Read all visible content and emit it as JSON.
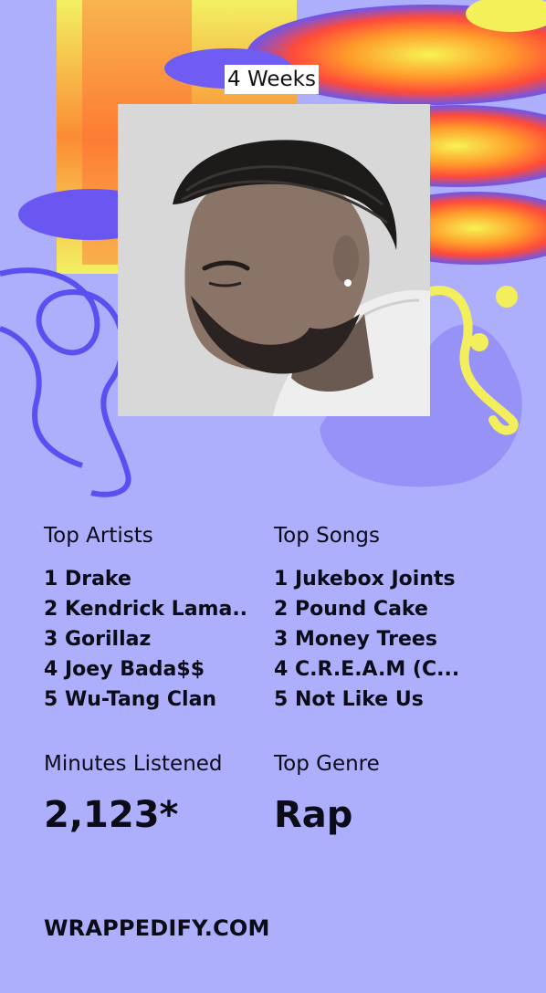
{
  "period_label": "4 Weeks",
  "top_artists": {
    "label": "Top Artists",
    "items": [
      "1 Drake",
      "2 Kendrick Lama..",
      "3 Gorillaz",
      "4 Joey Bada$$",
      "5 Wu-Tang Clan"
    ]
  },
  "top_songs": {
    "label": "Top Songs",
    "items": [
      "1 Jukebox Joints",
      "2 Pound Cake",
      "3 Money Trees",
      "4 C.R.E.A.M (C...",
      "5 Not Like Us"
    ]
  },
  "minutes": {
    "label": "Minutes Listened",
    "value": "2,123*"
  },
  "genre": {
    "label": "Top Genre",
    "value": "Rap"
  },
  "footer": {
    "brand": "WRAPPEDIFY.COM"
  },
  "colors": {
    "background": "#adaefc",
    "accent_yellow": "#f2f34a",
    "accent_orange": "#ff7a2e",
    "accent_blue": "#5a4ff0",
    "text": "#0c0c18"
  },
  "icons": {
    "background": "abstract-psychedelic-art",
    "photo": "artist-portrait-image"
  }
}
